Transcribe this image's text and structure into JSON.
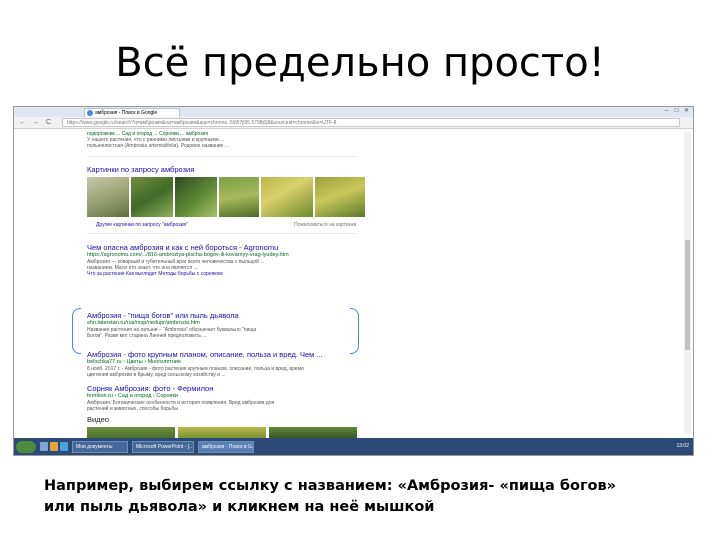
{
  "slide": {
    "title": "Всё предельно просто!",
    "caption_line1": "Например, выбирем ссылку с названием: «Амброзия- «пища богов»",
    "caption_line2": "или пыль дьявола» и кликнем на неё мышкой"
  },
  "browser": {
    "tab_title": "амброзия - Поиск в Google",
    "url": "https://www.google.ru/search?q=амброзия&oq=амброзия&aqs=chrome..69i57j0l5.5798j0j8&sourceid=chrome&ie=UTF-8",
    "window_controls": [
      "–",
      "□",
      "✕"
    ],
    "nav_buttons": [
      "←",
      "→",
      "C"
    ]
  },
  "serp": {
    "top_snippet": [
      "подорожник ... Сад и огород ... Сорняки ... амброзия",
      "У нашего растения, что с ранними листьями и крупными ...",
      "полынелистная (Ambrosia artemisiifolia). Родовое название ..."
    ],
    "images_heading": "Картинки по запросу амброзия",
    "more_images": "Другие картинки по запросу \"амброзия\"",
    "report_images": "Пожаловаться на картинки",
    "results": [
      {
        "title": "Чем опасна амброзия и как с ней бороться - Agronomu",
        "url": "https://agronomu.com/.../816-ambroziya-pischa-bogov-ili-kovarnyy-vrag-lyudey.htm",
        "snippet": [
          "Амброзия — коварный и губительный враг всего человечества с пыльцой ...",
          "названием. Мало кто знает, что она является ...",
          "Что за растение    Как выглядит    Методы борьбы с сорняком"
        ]
      },
      {
        "title": "Амброзия - \"пища богов\" или пыль дьявола",
        "url": "shn.tatarstan.ru/rus/rssp/nedupr/ambrozia.htm",
        "snippet": [
          "Название растения на латыни – \"Ambrosia\" обозначает буквально \"пища",
          "Богов\". Разве мог старина Линней предположить ..."
        ]
      },
      {
        "title": "Амброзия - фото крупным планом, описание, польза и вред. Чем ...",
        "url": "belochka77.ru › Цветы › Многолетние",
        "snippet": [
          "8 нояб. 2017 г. - Амброзия - фото растения крупным планом, описание, польза и вред, время",
          "цветения амброзии в Крыму, вред сельскому хозяйству и ..."
        ]
      },
      {
        "title": "Сорняк Амброзия: фото - Фермилон",
        "url": "fermilon.ru › Сад и огород › Сорняки",
        "snippet": [
          "Амброзия. Ботанические особенности и история появления. Вред амброзии для",
          "растений и животных, способы борьбы"
        ]
      }
    ],
    "video_heading": "Видео"
  },
  "taskbar": {
    "items": [
      "Мои документы",
      "Microsoft PowerPoint - [..",
      "амброзия - Поиск в G.."
    ],
    "clock": "13:02"
  },
  "colors": {
    "link": "#1a0dab",
    "url_green": "#006621",
    "highlight_bracket": "#4a86e8",
    "taskbar": "#2c4a75"
  }
}
